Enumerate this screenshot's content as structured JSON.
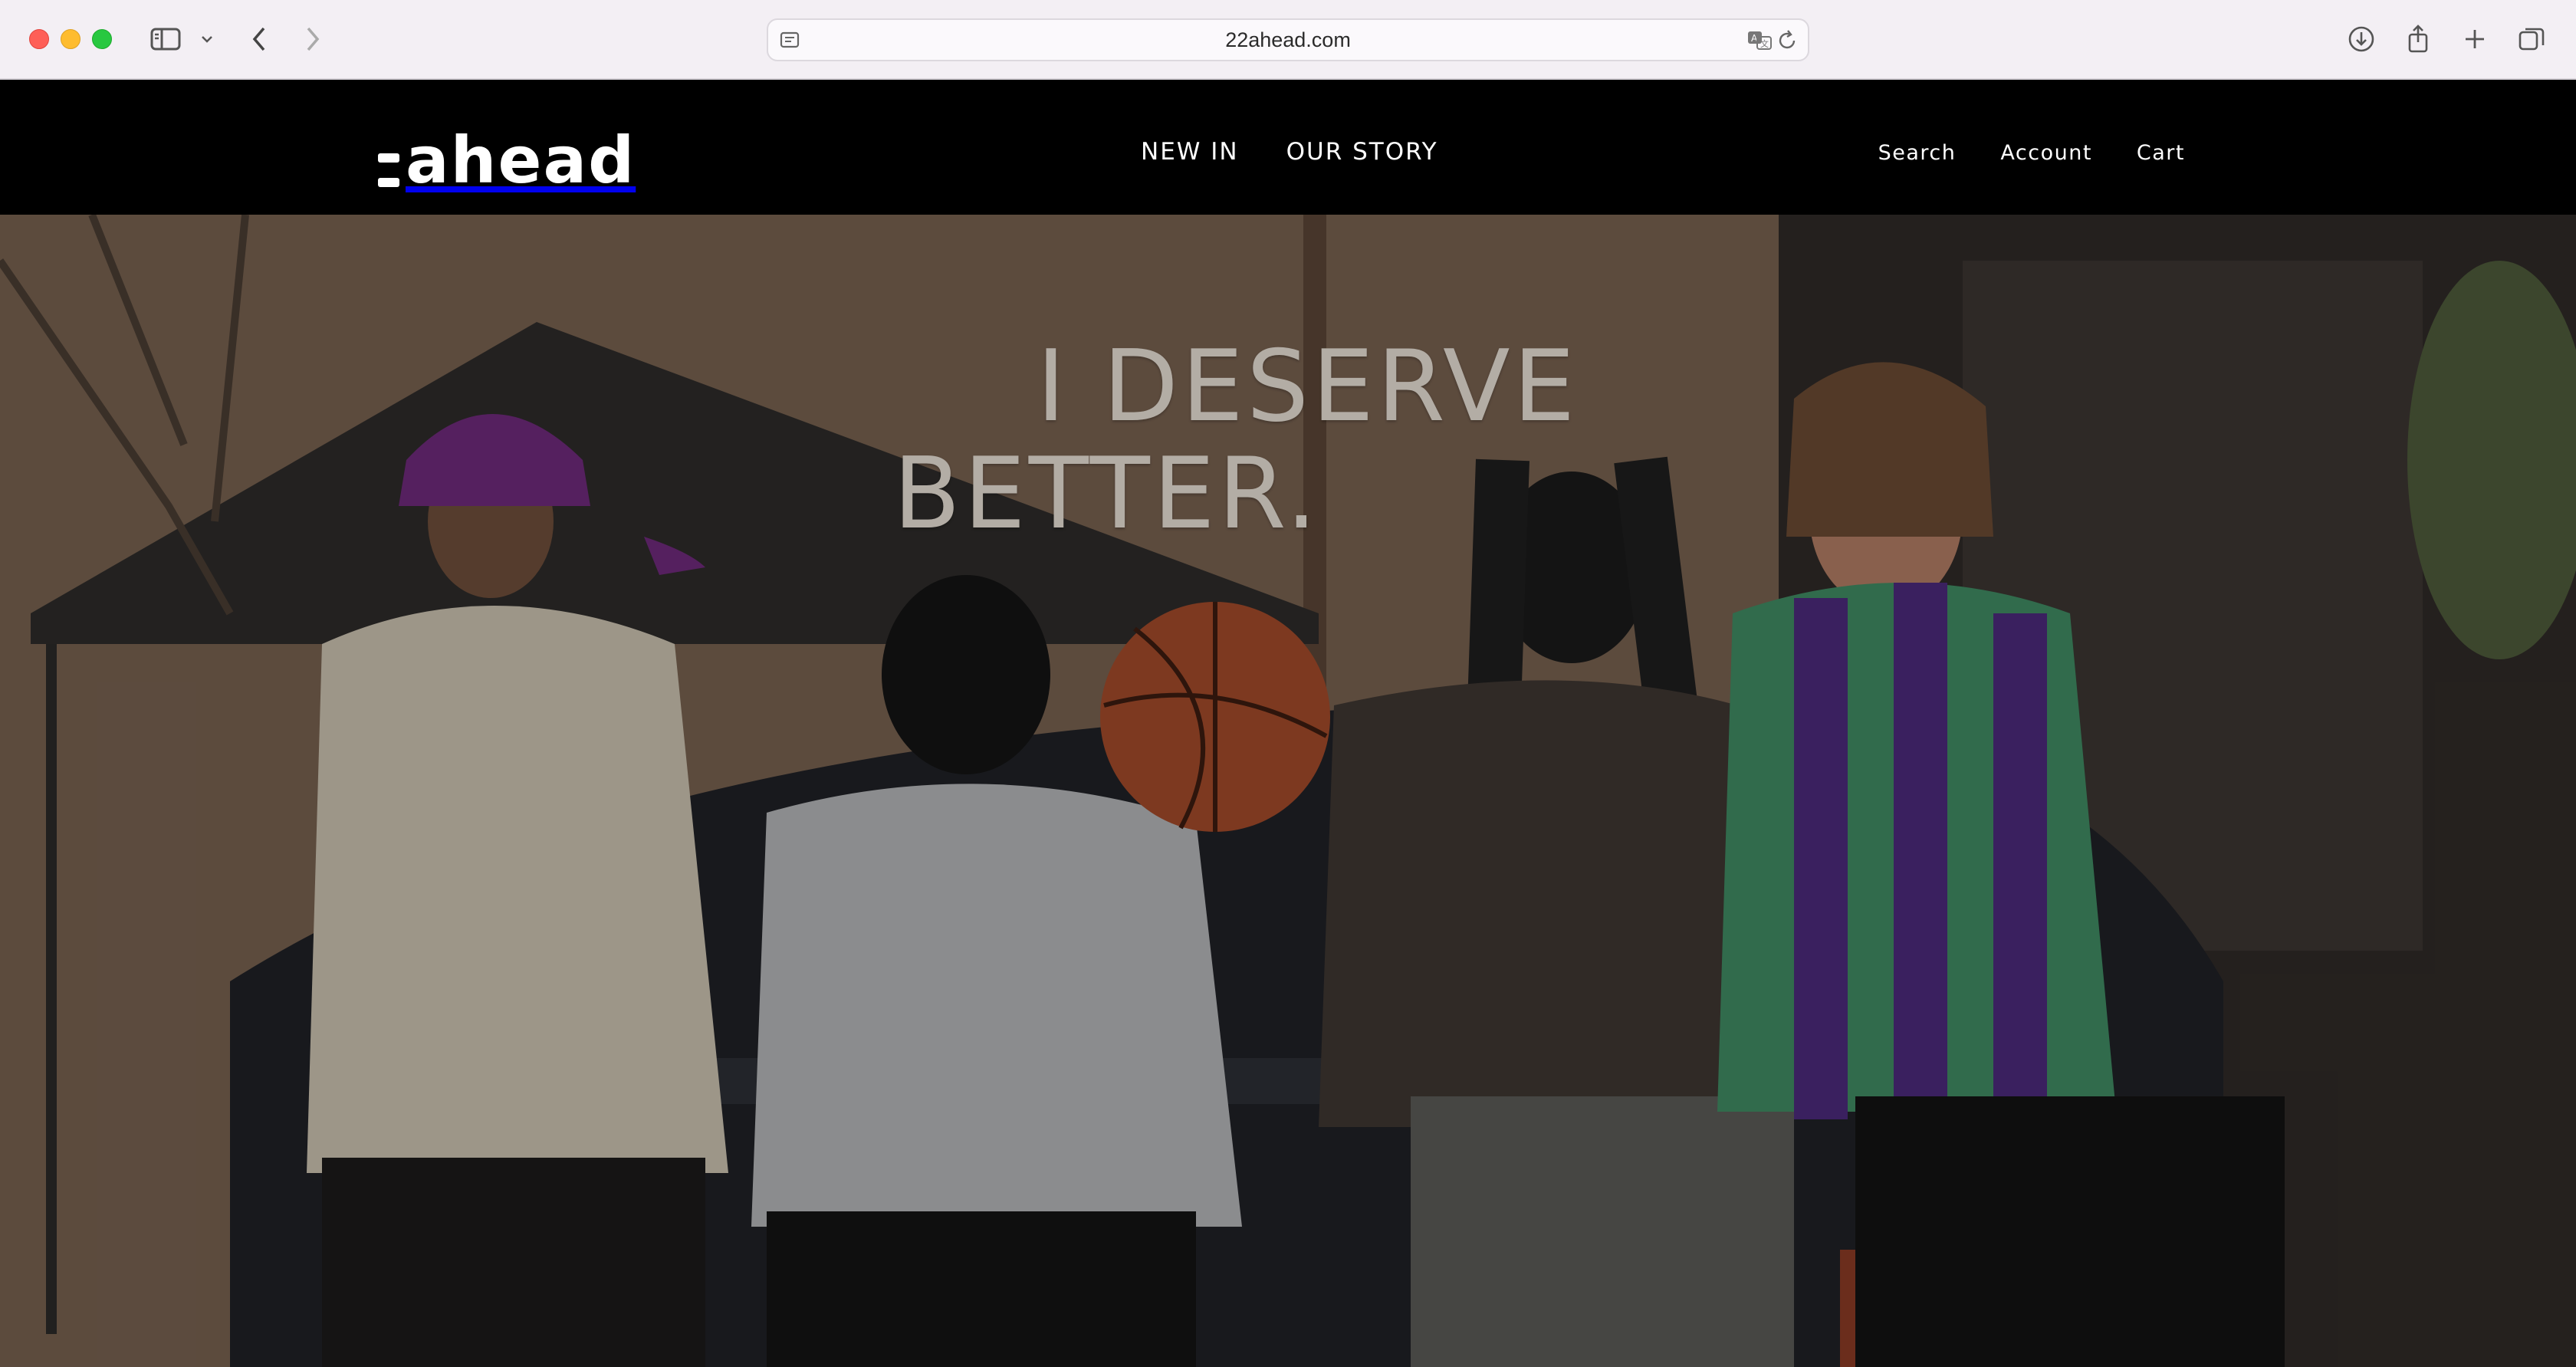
{
  "browser": {
    "url": "22ahead.com",
    "icons": {
      "sidebar": "sidebar-icon",
      "chevron": "chevron-down-icon",
      "back": "back-arrow-icon",
      "forward": "forward-arrow-icon",
      "page_menu": "page-menu-icon",
      "translate": "translate-icon",
      "reload": "reload-icon",
      "downloads": "download-icon",
      "share": "share-icon",
      "new_tab": "plus-icon",
      "tabs": "tabs-overview-icon"
    }
  },
  "site": {
    "logo_text": "ahead",
    "nav_center": [
      "NEW IN",
      "OUR STORY"
    ],
    "nav_right": [
      "Search",
      "Account",
      "Cart"
    ]
  },
  "hero": {
    "headline_line1": "I DESERVE",
    "headline_line2": "BETTER."
  },
  "colors": {
    "header_bg": "#000000",
    "chrome_bg": "#f3eff4",
    "headline": "#e6ded4"
  }
}
